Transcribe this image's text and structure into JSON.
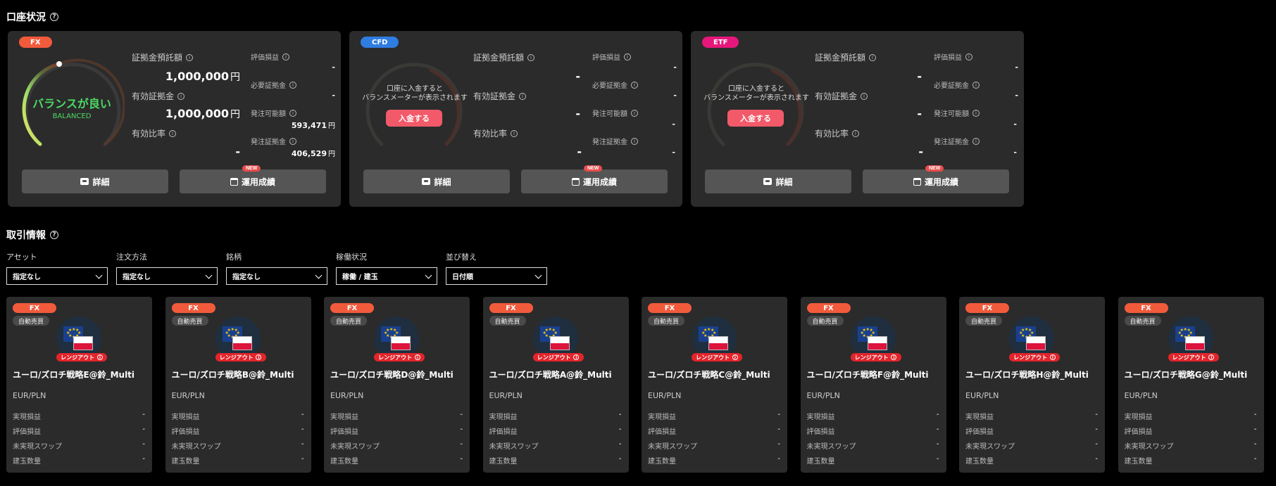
{
  "account_section": {
    "title": "口座状況",
    "help_icon": "?"
  },
  "account_cards": [
    {
      "badge": "FX",
      "badge_color": "#f25a3c",
      "balance_status": "バランスが良い",
      "balance_sub": "BALANCED",
      "deposit_message_line1": "",
      "deposit_message_line2": "",
      "deposit_button": "",
      "margin_deposit_label": "証拠金預託額",
      "margin_deposit_value": "1,000,000",
      "margin_deposit_unit": "円",
      "effective_margin_label": "有効証拠金",
      "effective_margin_value": "1,000,000",
      "effective_margin_unit": "円",
      "effective_ratio_label": "有効比率",
      "effective_ratio_value": "-",
      "valuation_pl_label": "評価損益",
      "valuation_pl_value": "-",
      "required_margin_label": "必要証拠金",
      "required_margin_value": "-",
      "order_available_label": "発注可能額",
      "order_available_value": "593,471",
      "order_available_unit": "円",
      "order_margin_label": "発注証拠金",
      "order_margin_value": "406,529",
      "order_margin_unit": "円",
      "detail_button": "詳細",
      "performance_button": "運用成績",
      "new_tag": "NEW"
    },
    {
      "badge": "CFD",
      "badge_color": "#2f7de1",
      "balance_status": "",
      "balance_sub": "",
      "deposit_message_line1": "口座に入金すると",
      "deposit_message_line2": "バランスメーターが表示されます",
      "deposit_button": "入金する",
      "margin_deposit_label": "証拠金預託額",
      "margin_deposit_value": "-",
      "margin_deposit_unit": "",
      "effective_margin_label": "有効証拠金",
      "effective_margin_value": "-",
      "effective_margin_unit": "",
      "effective_ratio_label": "有効比率",
      "effective_ratio_value": "-",
      "valuation_pl_label": "評価損益",
      "valuation_pl_value": "-",
      "required_margin_label": "必要証拠金",
      "required_margin_value": "-",
      "order_available_label": "発注可能額",
      "order_available_value": "-",
      "order_available_unit": "",
      "order_margin_label": "発注証拠金",
      "order_margin_value": "-",
      "order_margin_unit": "",
      "detail_button": "詳細",
      "performance_button": "運用成績",
      "new_tag": "NEW"
    },
    {
      "badge": "ETF",
      "badge_color": "#e6177a",
      "balance_status": "",
      "balance_sub": "",
      "deposit_message_line1": "口座に入金すると",
      "deposit_message_line2": "バランスメーターが表示されます",
      "deposit_button": "入金する",
      "margin_deposit_label": "証拠金預託額",
      "margin_deposit_value": "-",
      "margin_deposit_unit": "",
      "effective_margin_label": "有効証拠金",
      "effective_margin_value": "-",
      "effective_margin_unit": "",
      "effective_ratio_label": "有効比率",
      "effective_ratio_value": "-",
      "valuation_pl_label": "評価損益",
      "valuation_pl_value": "-",
      "required_margin_label": "必要証拠金",
      "required_margin_value": "-",
      "order_available_label": "発注可能額",
      "order_available_value": "-",
      "order_available_unit": "",
      "order_margin_label": "発注証拠金",
      "order_margin_value": "-",
      "order_margin_unit": "",
      "detail_button": "詳細",
      "performance_button": "運用成績",
      "new_tag": "NEW"
    }
  ],
  "trade_section": {
    "title": "取引情報",
    "help_icon": "?"
  },
  "filters": [
    {
      "label": "アセット",
      "value": "指定なし"
    },
    {
      "label": "注文方法",
      "value": "指定なし"
    },
    {
      "label": "銘柄",
      "value": "指定なし"
    },
    {
      "label": "稼働状況",
      "value": "稼働 / 建玉"
    },
    {
      "label": "並び替え",
      "value": "日付順"
    }
  ],
  "strategy_common": {
    "badge": "FX",
    "auto_label": "自動売買",
    "range_out": "レンジアウト",
    "pair": "EUR/PLN",
    "realized_pl_label": "実現損益",
    "valuation_pl_label": "評価損益",
    "unrealized_swap_label": "未実現スワップ",
    "position_qty_label": "建玉数量",
    "empty_value": "-"
  },
  "strategies": [
    {
      "name": "ユーロ/ズロチ戦略E@鈴_Multi"
    },
    {
      "name": "ユーロ/ズロチ戦略B@鈴_Multi"
    },
    {
      "name": "ユーロ/ズロチ戦略D@鈴_Multi"
    },
    {
      "name": "ユーロ/ズロチ戦略A@鈴_Multi"
    },
    {
      "name": "ユーロ/ズロチ戦略C@鈴_Multi"
    },
    {
      "name": "ユーロ/ズロチ戦略F@鈴_Multi"
    },
    {
      "name": "ユーロ/ズロチ戦略H@鈴_Multi"
    },
    {
      "name": "ユーロ/ズロチ戦略G@鈴_Multi"
    }
  ]
}
